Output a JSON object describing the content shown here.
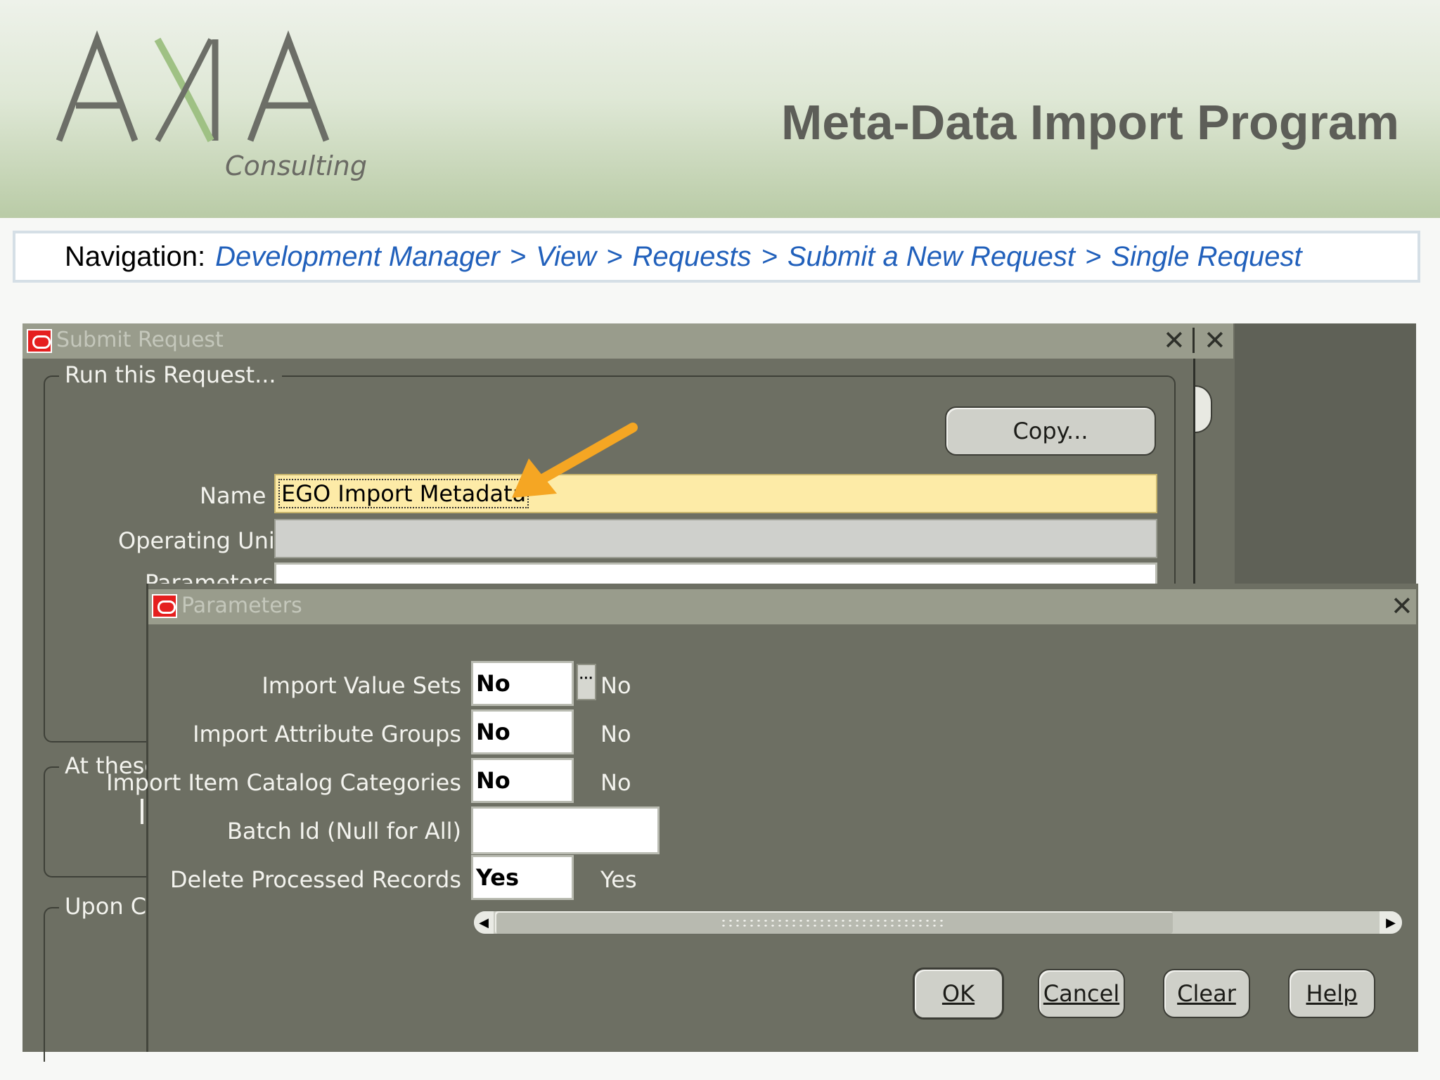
{
  "logo": {
    "text": "AXIA",
    "tagline": "Consulting"
  },
  "slide_title": "Meta-Data Import Program",
  "navigation": {
    "prefix": "Navigation:",
    "path": [
      "Development Manager",
      "View",
      "Requests",
      "Submit a New Request",
      "Single Request"
    ],
    "separator": ">"
  },
  "submit_request": {
    "title": "Submit Request",
    "run_group_title": "Run this Request...",
    "copy_button": "Copy...",
    "name_label": "Name",
    "name_value": "EGO Import Metadata",
    "operating_unit_label": "Operating Unit",
    "operating_unit_value": "",
    "parameters_label": "Parameters",
    "at_these_label": "At these",
    "upon_label": "Upon Co"
  },
  "parameters_dialog": {
    "title": "Parameters",
    "rows": [
      {
        "label": "Import Value Sets",
        "value": "No",
        "description": "No"
      },
      {
        "label": "Import Attribute Groups",
        "value": "No",
        "description": "No"
      },
      {
        "label": "Import Item Catalog Categories",
        "value": "No",
        "description": "No"
      },
      {
        "label": "Batch Id (Null for All)",
        "value": "",
        "description": ""
      },
      {
        "label": "Delete Processed Records",
        "value": "Yes",
        "description": "Yes"
      }
    ],
    "buttons": {
      "ok": "OK",
      "cancel": "Cancel",
      "clear": "Clear",
      "help": "Help"
    }
  },
  "colors": {
    "name_field_highlight": "#fdeba7",
    "arrow": "#f5a623",
    "nav_link": "#2160bb",
    "oracle_red": "#e51f1f"
  }
}
